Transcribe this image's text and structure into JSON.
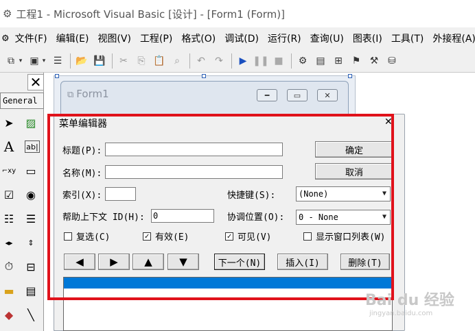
{
  "window": {
    "title": "工程1 - Microsoft Visual Basic [设计] - [Form1 (Form)]"
  },
  "menu": [
    "文件(F)",
    "编辑(E)",
    "视图(V)",
    "工程(P)",
    "格式(O)",
    "调试(D)",
    "运行(R)",
    "查询(U)",
    "图表(I)",
    "工具(T)",
    "外接程(A)"
  ],
  "toolbox": {
    "header": "General"
  },
  "form1": {
    "title": "Form1"
  },
  "menu_editor": {
    "title": "菜单编辑器",
    "caption_label": "标题(P):",
    "caption_value": "",
    "name_label": "名称(M):",
    "name_value": "",
    "index_label": "索引(X):",
    "index_value": "",
    "shortcut_label": "快捷键(S):",
    "shortcut_value": "(None)",
    "helpid_label": "帮助上下文 ID(H):",
    "helpid_value": "0",
    "negotiate_label": "协调位置(O):",
    "negotiate_value": "0 - None",
    "checked_label": "复选(C)",
    "checked": false,
    "enabled_label": "有效(E)",
    "enabled": true,
    "visible_label": "可见(V)",
    "visible": true,
    "windowlist_label": "显示窗口列表(W)",
    "windowlist": false,
    "ok_label": "确定",
    "cancel_label": "取消",
    "next_label": "下一个(N)",
    "insert_label": "插入(I)",
    "delete_label": "删除(T)"
  },
  "watermark": {
    "text": "Bai du 经验",
    "sub": "jingyan.baidu.com"
  },
  "colors": {
    "highlight": "#0078d7",
    "annotation_red": "#e0121b"
  }
}
